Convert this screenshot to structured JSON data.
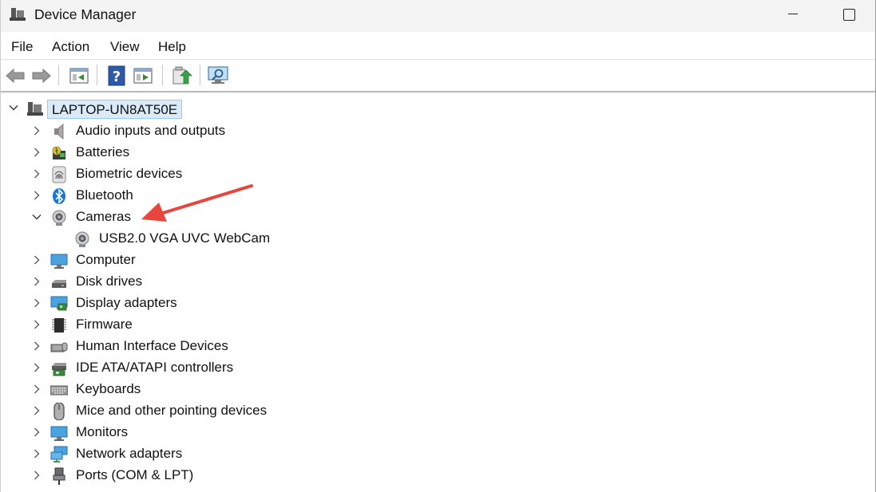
{
  "window": {
    "title": "Device Manager"
  },
  "menu": [
    "File",
    "Action",
    "View",
    "Help"
  ],
  "toolbar_icons": [
    "back-icon",
    "forward-icon",
    "properties-icon",
    "help-icon",
    "run-icon",
    "update-driver-icon",
    "scan-hardware-icon"
  ],
  "tree": {
    "root": "LAPTOP-UN8AT50E",
    "categories": [
      {
        "label": "Audio inputs and outputs",
        "icon": "speaker-icon",
        "expanded": false
      },
      {
        "label": "Batteries",
        "icon": "battery-icon",
        "expanded": false
      },
      {
        "label": "Biometric devices",
        "icon": "fingerprint-icon",
        "expanded": false
      },
      {
        "label": "Bluetooth",
        "icon": "bluetooth-icon",
        "expanded": false
      },
      {
        "label": "Cameras",
        "icon": "camera-icon",
        "expanded": true,
        "children": [
          "USB2.0 VGA UVC WebCam"
        ]
      },
      {
        "label": "Computer",
        "icon": "monitor-icon",
        "expanded": false
      },
      {
        "label": "Disk drives",
        "icon": "disk-drive-icon",
        "expanded": false
      },
      {
        "label": "Display adapters",
        "icon": "display-adapter-icon",
        "expanded": false
      },
      {
        "label": "Firmware",
        "icon": "chip-icon",
        "expanded": false
      },
      {
        "label": "Human Interface Devices",
        "icon": "hid-icon",
        "expanded": false
      },
      {
        "label": "IDE ATA/ATAPI controllers",
        "icon": "ide-controller-icon",
        "expanded": false
      },
      {
        "label": "Keyboards",
        "icon": "keyboard-icon",
        "expanded": false
      },
      {
        "label": "Mice and other pointing devices",
        "icon": "mouse-icon",
        "expanded": false
      },
      {
        "label": "Monitors",
        "icon": "monitor-icon",
        "expanded": false
      },
      {
        "label": "Network adapters",
        "icon": "network-icon",
        "expanded": false
      },
      {
        "label": "Ports (COM & LPT)",
        "icon": "port-icon",
        "expanded": false
      }
    ]
  },
  "annotation": {
    "type": "arrow",
    "color": "#e8453c",
    "points_to": "Cameras"
  }
}
